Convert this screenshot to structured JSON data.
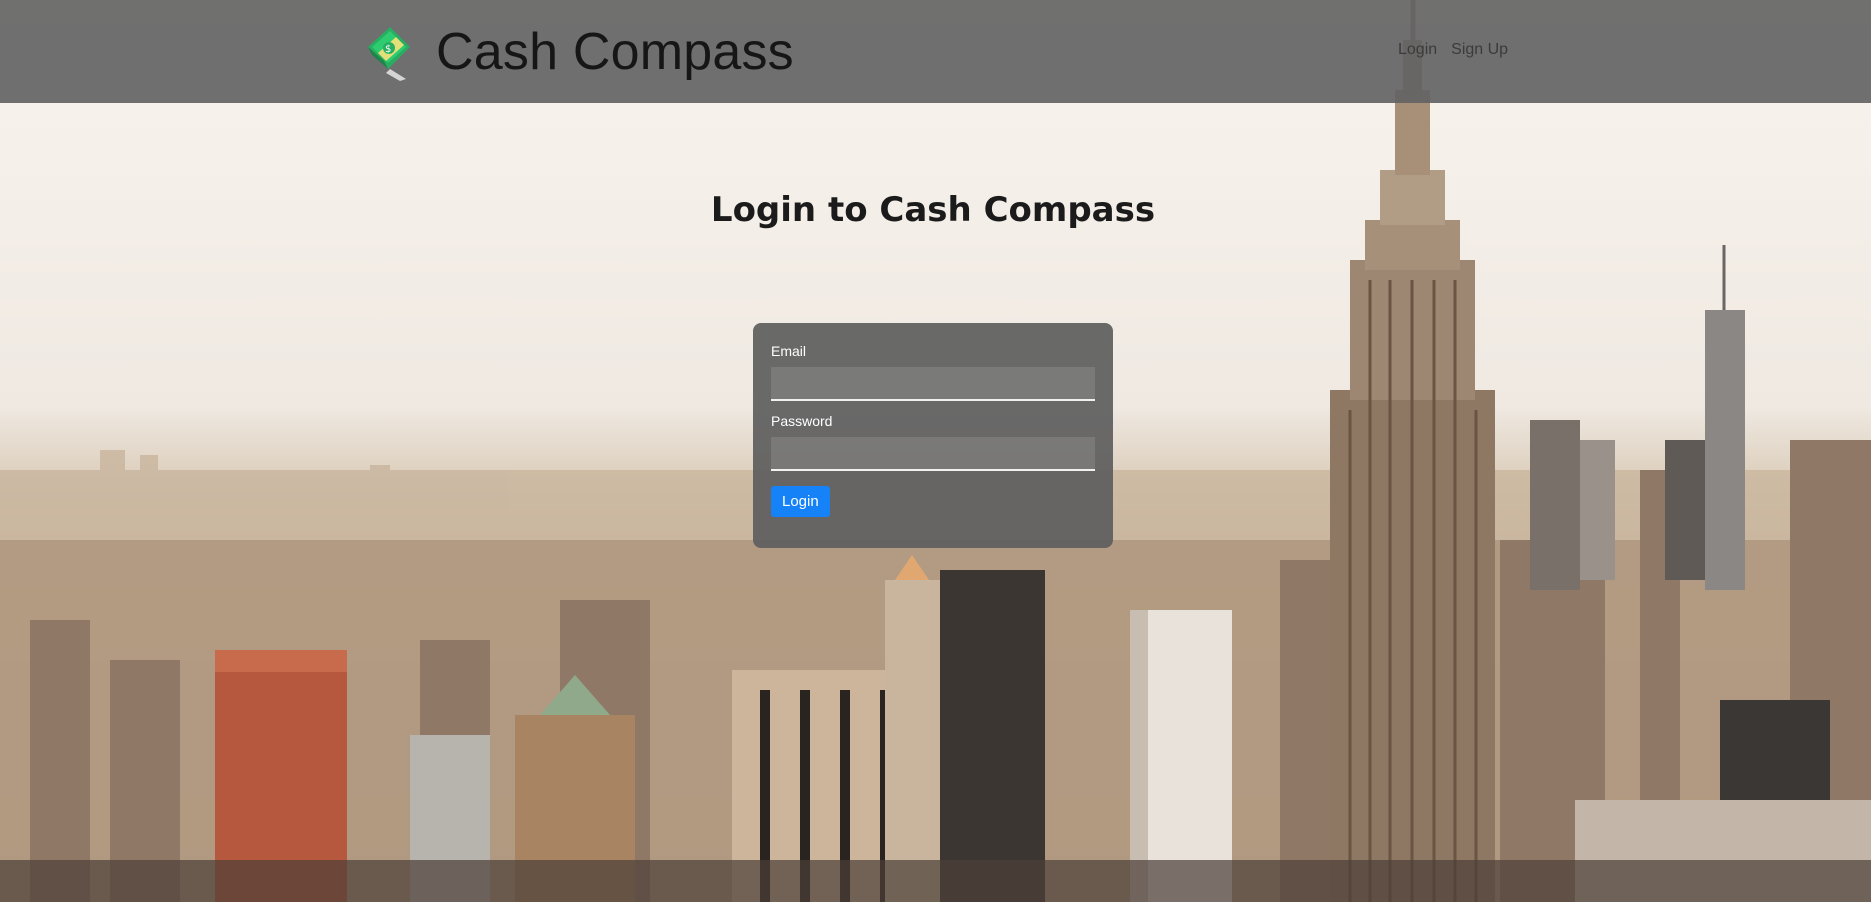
{
  "navbar": {
    "brand_name": "Cash Compass",
    "logo_icon": "money-bill-icon",
    "links": [
      {
        "label": "Login"
      },
      {
        "label": "Sign Up"
      }
    ]
  },
  "page": {
    "title": "Login to Cash Compass"
  },
  "login_form": {
    "email_label": "Email",
    "email_value": "",
    "password_label": "Password",
    "password_value": "",
    "submit_label": "Login"
  },
  "colors": {
    "navbar_bg": "#646464",
    "card_bg": "#5f5f5f",
    "button_primary": "#1582f7",
    "logo_green": "#2ecc71"
  }
}
